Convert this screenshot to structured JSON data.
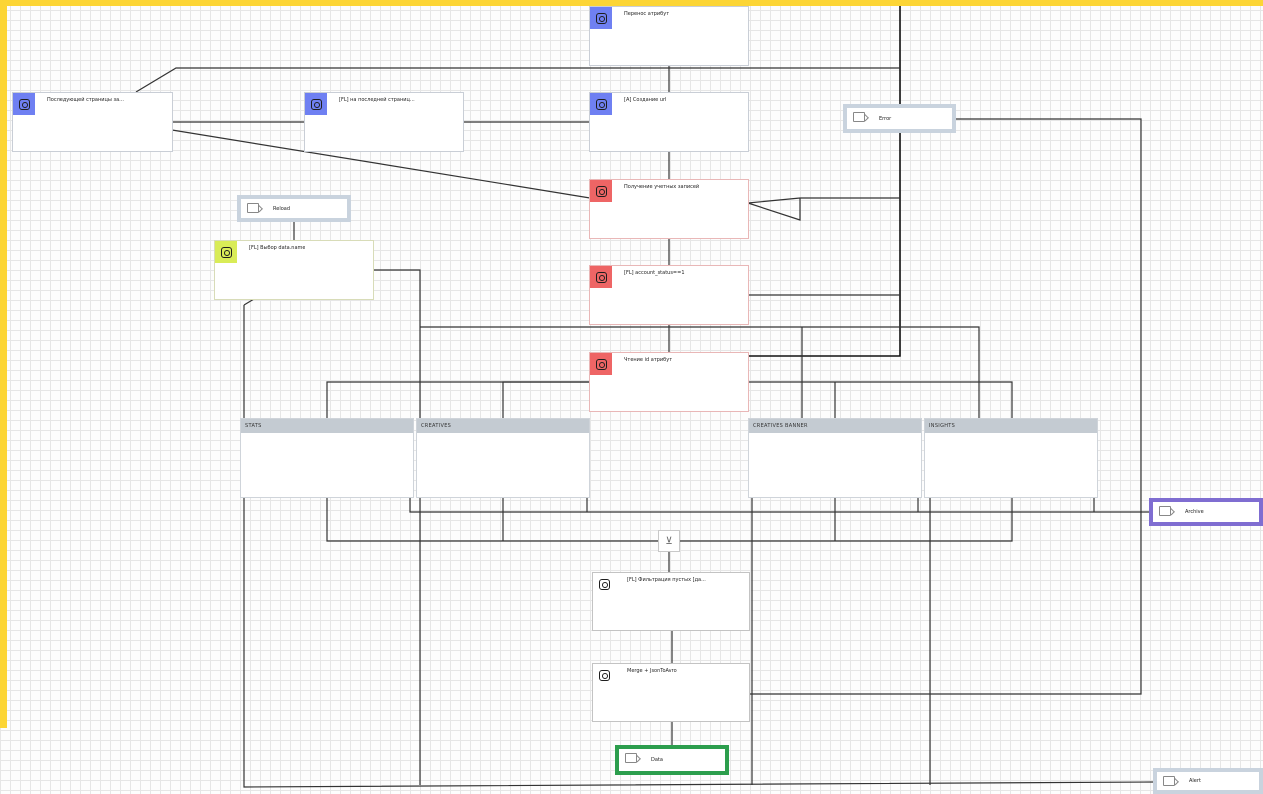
{
  "diagram": {
    "nodes": [
      {
        "id": "n1",
        "label": "Перенос атрибут",
        "color": "blue"
      },
      {
        "id": "n2",
        "label": "Последующей страницы за...",
        "color": "blue"
      },
      {
        "id": "n3",
        "label": "[FL] на последней страниц...",
        "color": "blue"
      },
      {
        "id": "n4",
        "label": "[A] Создание url",
        "color": "blue"
      },
      {
        "id": "n5",
        "label": "Получение учетных записей",
        "color": "red"
      },
      {
        "id": "n6",
        "label": "[FL] Выбор data.name",
        "color": "lime"
      },
      {
        "id": "n7",
        "label": "[FL] account_status==1",
        "color": "red"
      },
      {
        "id": "n8",
        "label": "Чтение id атрибут",
        "color": "red"
      },
      {
        "id": "n9",
        "label": "[FL] Фильтрация пустых [да...",
        "color": "outline"
      },
      {
        "id": "n10",
        "label": "Merge + JsonToAvro",
        "color": "outline"
      }
    ],
    "ports": [
      {
        "id": "p_error",
        "label": "Error",
        "color": "grey"
      },
      {
        "id": "p_reload",
        "label": "Reload",
        "color": "grey"
      },
      {
        "id": "p_archive",
        "label": "Archive",
        "color": "purple"
      },
      {
        "id": "p_data",
        "label": "Data",
        "color": "green"
      },
      {
        "id": "p_alert",
        "label": "Alert",
        "color": "grey"
      }
    ],
    "groups": [
      {
        "id": "g1",
        "label": "STATS"
      },
      {
        "id": "g2",
        "label": "CREATIVES"
      },
      {
        "id": "g3",
        "label": "CREATIVES BANNER"
      },
      {
        "id": "g4",
        "label": "INSIGHTS"
      }
    ],
    "merge_icon": "funnel-merge-icon",
    "colors": {
      "frame": "#fcd535",
      "blue": "#6f80f2",
      "red": "#ee6565",
      "lime": "#d9ec57",
      "archive": "#7f6dd1",
      "data": "#2c9e4d",
      "group_header": "#c4cbd2"
    }
  }
}
